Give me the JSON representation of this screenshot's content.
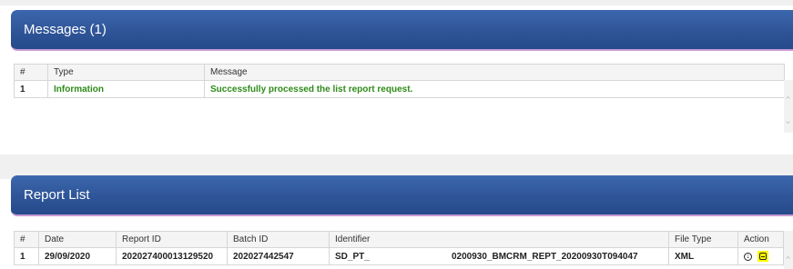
{
  "messages_panel": {
    "title": "Messages (1)",
    "columns": [
      "#",
      "Type",
      "Message"
    ],
    "rows": [
      {
        "num": "1",
        "type": "Information",
        "message": "Successfully processed the list report request."
      }
    ]
  },
  "report_panel": {
    "title": "Report List",
    "columns": [
      "#",
      "Date",
      "Report ID",
      "Batch ID",
      "Identifier",
      "File Type",
      "Action"
    ],
    "rows": [
      {
        "num": "1",
        "date": "29/09/2020",
        "report_id": "202027400013129520",
        "batch_id": "202027442547",
        "identifier_prefix": "SD_PT_",
        "identifier_suffix": "0200930_BMCRM_REPT_20200930T094047",
        "file_type": "XML",
        "actions": [
          "download-icon",
          "view-document-icon"
        ]
      }
    ]
  },
  "colors": {
    "header_blue": "#2f5598",
    "header_underline": "#c69bd4",
    "success_green": "#2e8b18",
    "highlight_yellow": "#ffff00"
  }
}
